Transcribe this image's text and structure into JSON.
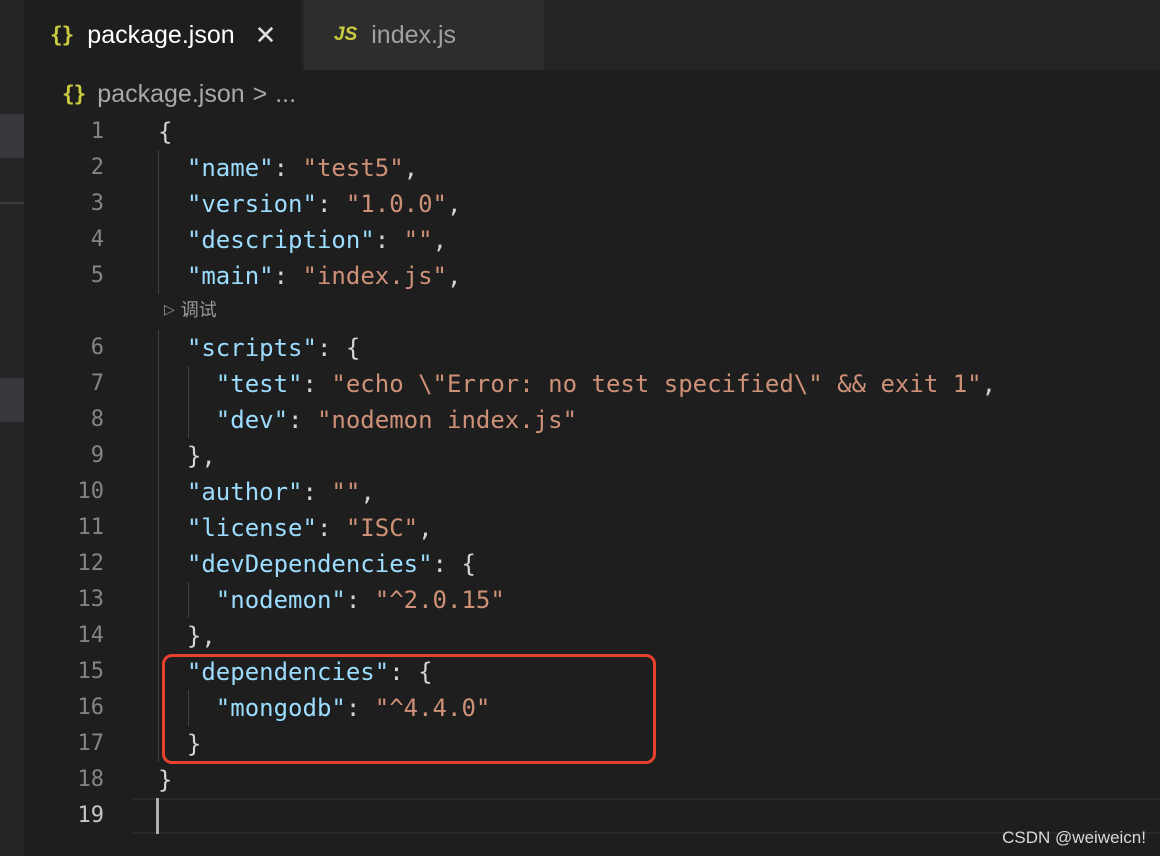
{
  "tabs": [
    {
      "icon": "{}",
      "label": "package.json",
      "active": true
    },
    {
      "icon": "JS",
      "label": "index.js",
      "active": false
    }
  ],
  "tab_close_glyph": "✕",
  "breadcrumb": {
    "icon": "{}",
    "file": "package.json",
    "separator": ">",
    "more": "..."
  },
  "codelens": {
    "icon": "play-icon",
    "label": "调试"
  },
  "line_numbers": [
    "1",
    "2",
    "3",
    "4",
    "5",
    "6",
    "7",
    "8",
    "9",
    "10",
    "11",
    "12",
    "13",
    "14",
    "15",
    "16",
    "17",
    "18",
    "19"
  ],
  "current_line": "19",
  "code": {
    "l1": "{",
    "l2_key": "\"name\"",
    "l2_val": "\"test5\"",
    "l3_key": "\"version\"",
    "l3_val": "\"1.0.0\"",
    "l4_key": "\"description\"",
    "l4_val": "\"\"",
    "l5_key": "\"main\"",
    "l5_val": "\"index.js\"",
    "l6_key": "\"scripts\"",
    "l7_key": "\"test\"",
    "l7_val": "\"echo \\\"Error: no test specified\\\" && exit 1\"",
    "l8_key": "\"dev\"",
    "l8_val": "\"nodemon index.js\"",
    "l9": "},",
    "l10_key": "\"author\"",
    "l10_val": "\"\"",
    "l11_key": "\"license\"",
    "l11_val": "\"ISC\"",
    "l12_key": "\"devDependencies\"",
    "l13_key": "\"nodemon\"",
    "l13_val": "\"^2.0.15\"",
    "l14": "},",
    "l15_key": "\"dependencies\"",
    "l16_key": "\"mongodb\"",
    "l16_val": "\"^4.4.0\"",
    "l17": "}",
    "l18": "}"
  },
  "watermark": "CSDN @weiweicn!",
  "colors": {
    "background": "#1e1e1e",
    "json_key": "#9cdcfe",
    "json_string": "#ce9178",
    "punctuation": "#d4d4d4",
    "icon_yellow": "#cbcb41",
    "highlight_box": "#e8402f"
  }
}
